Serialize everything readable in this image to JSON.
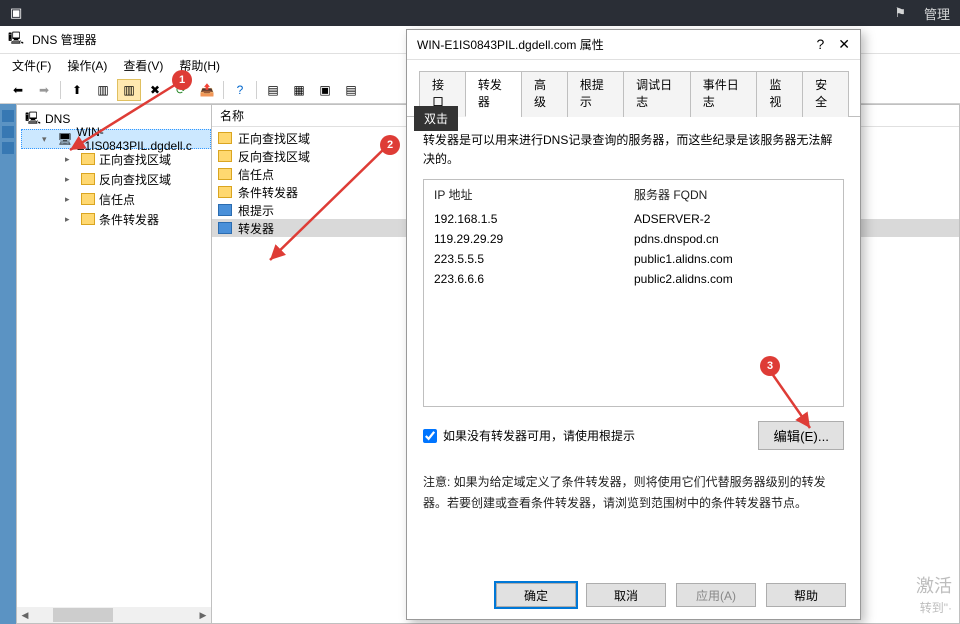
{
  "topbar": {
    "right": "管理"
  },
  "window": {
    "title": "DNS 管理器"
  },
  "menu": {
    "file": "文件(F)",
    "action": "操作(A)",
    "view": "查看(V)",
    "help": "帮助(H)"
  },
  "tree": {
    "root": "DNS",
    "server": "WIN-E1IS0843PIL.dgdell.c",
    "items": [
      "正向查找区域",
      "反向查找区域",
      "信任点",
      "条件转发器"
    ]
  },
  "list": {
    "header": "名称",
    "items": [
      "正向查找区域",
      "反向查找区域",
      "信任点",
      "条件转发器",
      "根提示",
      "转发器"
    ]
  },
  "dialog": {
    "title": "WIN-E1IS0843PIL.dgdell.com 属性",
    "help": "?",
    "close": "✕",
    "tabs": [
      "接口",
      "转发器",
      "高级",
      "根提示",
      "调试日志",
      "事件日志",
      "监视",
      "安全"
    ],
    "active_tab": 1,
    "desc": "转发器是可以用来进行DNS记录查询的服务器，而这些纪录是该服务器无法解决的。",
    "fwd": {
      "col1": "IP 地址",
      "col2": "服务器 FQDN",
      "rows": [
        {
          "ip": "192.168.1.5",
          "fqdn": "ADSERVER-2"
        },
        {
          "ip": "119.29.29.29",
          "fqdn": "pdns.dnspod.cn"
        },
        {
          "ip": "223.5.5.5",
          "fqdn": "public1.alidns.com"
        },
        {
          "ip": "223.6.6.6",
          "fqdn": "public2.alidns.com"
        }
      ]
    },
    "use_root_hints": "如果没有转发器可用，请使用根提示",
    "edit_btn": "编辑(E)...",
    "note": "注意: 如果为给定域定义了条件转发器，则将使用它们代替服务器级别的转发器。若要创建或查看条件转发器，请浏览到范围树中的条件转发器节点。",
    "ok": "确定",
    "cancel": "取消",
    "apply": "应用(A)",
    "helpb": "帮助"
  },
  "tooltip": "双击",
  "badges": {
    "b1": "1",
    "b2": "2",
    "b3": "3"
  },
  "watermark": {
    "l1": "激活",
    "l2": "转到\"·"
  }
}
